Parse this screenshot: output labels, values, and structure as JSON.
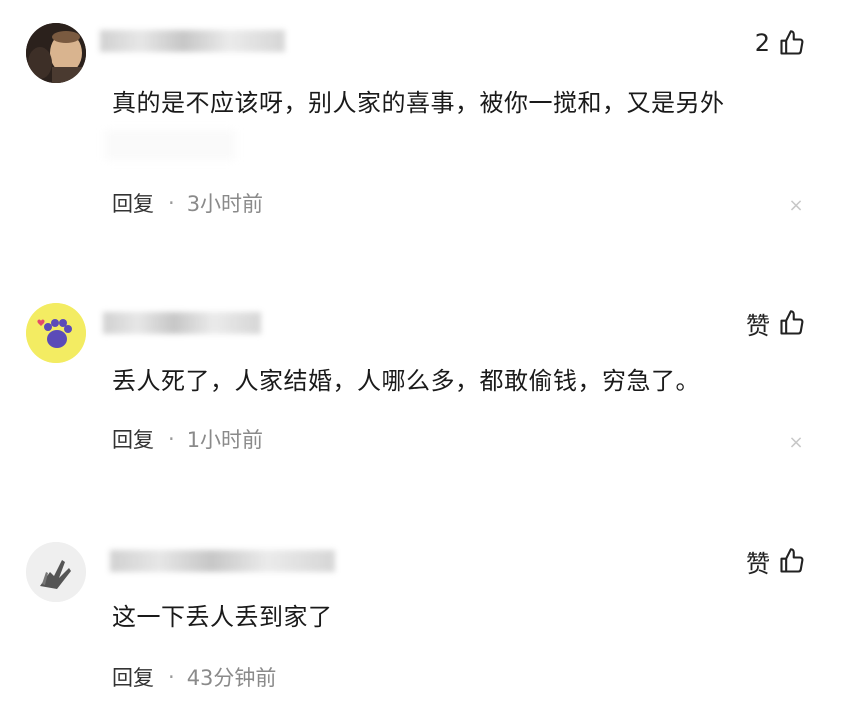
{
  "comments": [
    {
      "like_label": "2",
      "text": "真的是不应该呀，别人家的喜事，被你一搅和，又是另外",
      "reply_label": "回复",
      "separator": "·",
      "time": "3小时前",
      "close_glyph": "×"
    },
    {
      "like_label": "赞",
      "text": "丢人死了，人家结婚，人哪么多，都敢偷钱，穷急了。",
      "reply_label": "回复",
      "separator": "·",
      "time": "1小时前",
      "close_glyph": "×"
    },
    {
      "like_label": "赞",
      "text": "这一下丢人丢到家了",
      "reply_label": "回复",
      "separator": "·",
      "time": "43分钟前"
    }
  ],
  "icons": {
    "like": "thumbs-up-icon",
    "close": "close-icon"
  },
  "colors": {
    "text": "#1a1a1a",
    "meta": "#8a8a8a",
    "close": "#c7c7c7"
  }
}
